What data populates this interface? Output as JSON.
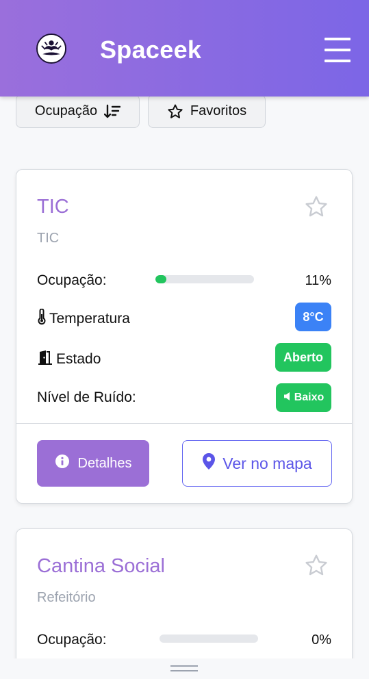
{
  "app": {
    "brand": "Spaceek",
    "logo_icon": "meditation-logo-icon",
    "menu_icon": "hamburger-menu-icon"
  },
  "filters": {
    "occupancy_label": "Ocupação",
    "occupancy_icon": "sort-descending-icon",
    "favorites_label": "Favoritos",
    "favorites_icon": "star-outline-icon"
  },
  "spaces": [
    {
      "title": "TIC",
      "subtitle": "TIC",
      "occupancy_label": "Ocupação:",
      "occupancy_percent": 11,
      "occupancy_text": "11%",
      "temperature_label": "Temperatura",
      "temperature_value": "8°C",
      "temperature_color": "#3b82f6",
      "state_label": "Estado",
      "state_value": "Aberto",
      "state_color": "#22c55e",
      "noise_label": "Nível de Ruído:",
      "noise_value": "Baixo",
      "noise_color": "#22c55e",
      "details_label": "Detalhes",
      "map_label": "Ver no mapa"
    },
    {
      "title": "Cantina Social",
      "subtitle": "Refeitório",
      "occupancy_label": "Ocupação:",
      "occupancy_percent": 0,
      "occupancy_text": "0%"
    }
  ],
  "colors": {
    "accent": "#9b6fd6",
    "header_gradient_start": "#9a6fdc",
    "header_gradient_end": "#7c66e6",
    "map_button": "#5b55e8"
  }
}
